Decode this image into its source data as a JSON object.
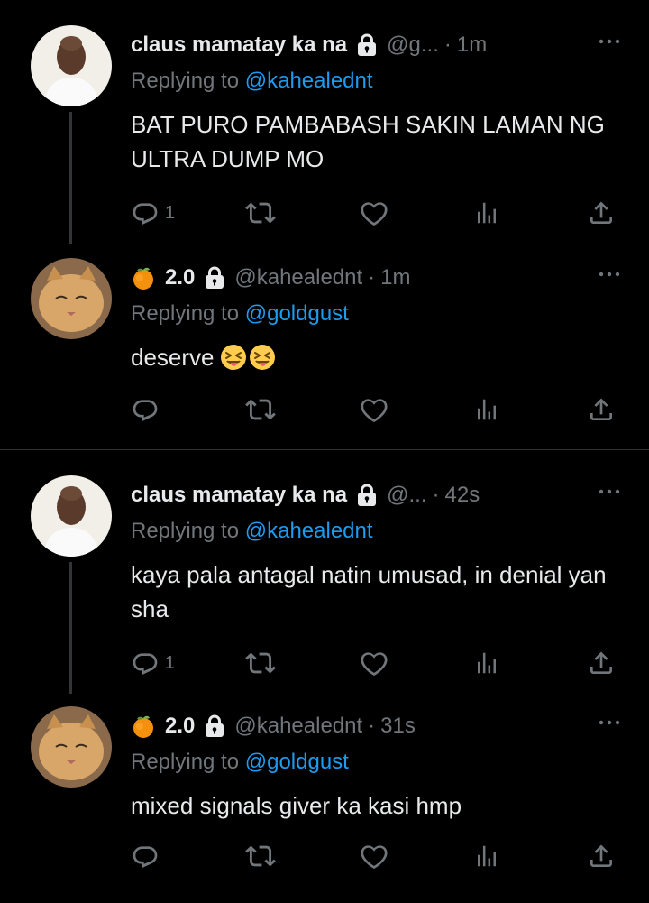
{
  "threads": [
    {
      "tweets": [
        {
          "name": "claus mamatay ka na",
          "handle": "@g...",
          "time": "1m",
          "replying_prefix": "Replying to",
          "replying_to": "@kahealednt",
          "text": "BAT PURO PAMBABASH SAKIN LAMAN NG ULTRA DUMP MO",
          "reply_count": "1"
        },
        {
          "name": "2.0",
          "handle": "@kahealednt",
          "time": "1m",
          "replying_prefix": "Replying to",
          "replying_to": "@goldgust",
          "text": "deserve",
          "reply_count": ""
        }
      ]
    },
    {
      "tweets": [
        {
          "name": "claus mamatay ka na",
          "handle": "@...",
          "time": "42s",
          "replying_prefix": "Replying to",
          "replying_to": "@kahealednt",
          "text": "kaya pala antagal natin umusad, in denial yan sha",
          "reply_count": "1"
        },
        {
          "name": "2.0",
          "handle": "@kahealednt",
          "time": "31s",
          "replying_prefix": "Replying to",
          "replying_to": "@goldgust",
          "text": "mixed signals giver ka kasi hmp",
          "reply_count": ""
        }
      ]
    }
  ],
  "colors": {
    "background": "#000000",
    "text": "#e7e9ea",
    "muted": "#71767b",
    "link": "#1d9bf0",
    "divider": "#2f3336"
  },
  "icons": [
    "lock-icon",
    "peach-emoji-icon",
    "more-icon",
    "reply-icon",
    "retweet-icon",
    "like-icon",
    "views-icon",
    "share-icon",
    "squinting-tongue-emoji-icon"
  ]
}
